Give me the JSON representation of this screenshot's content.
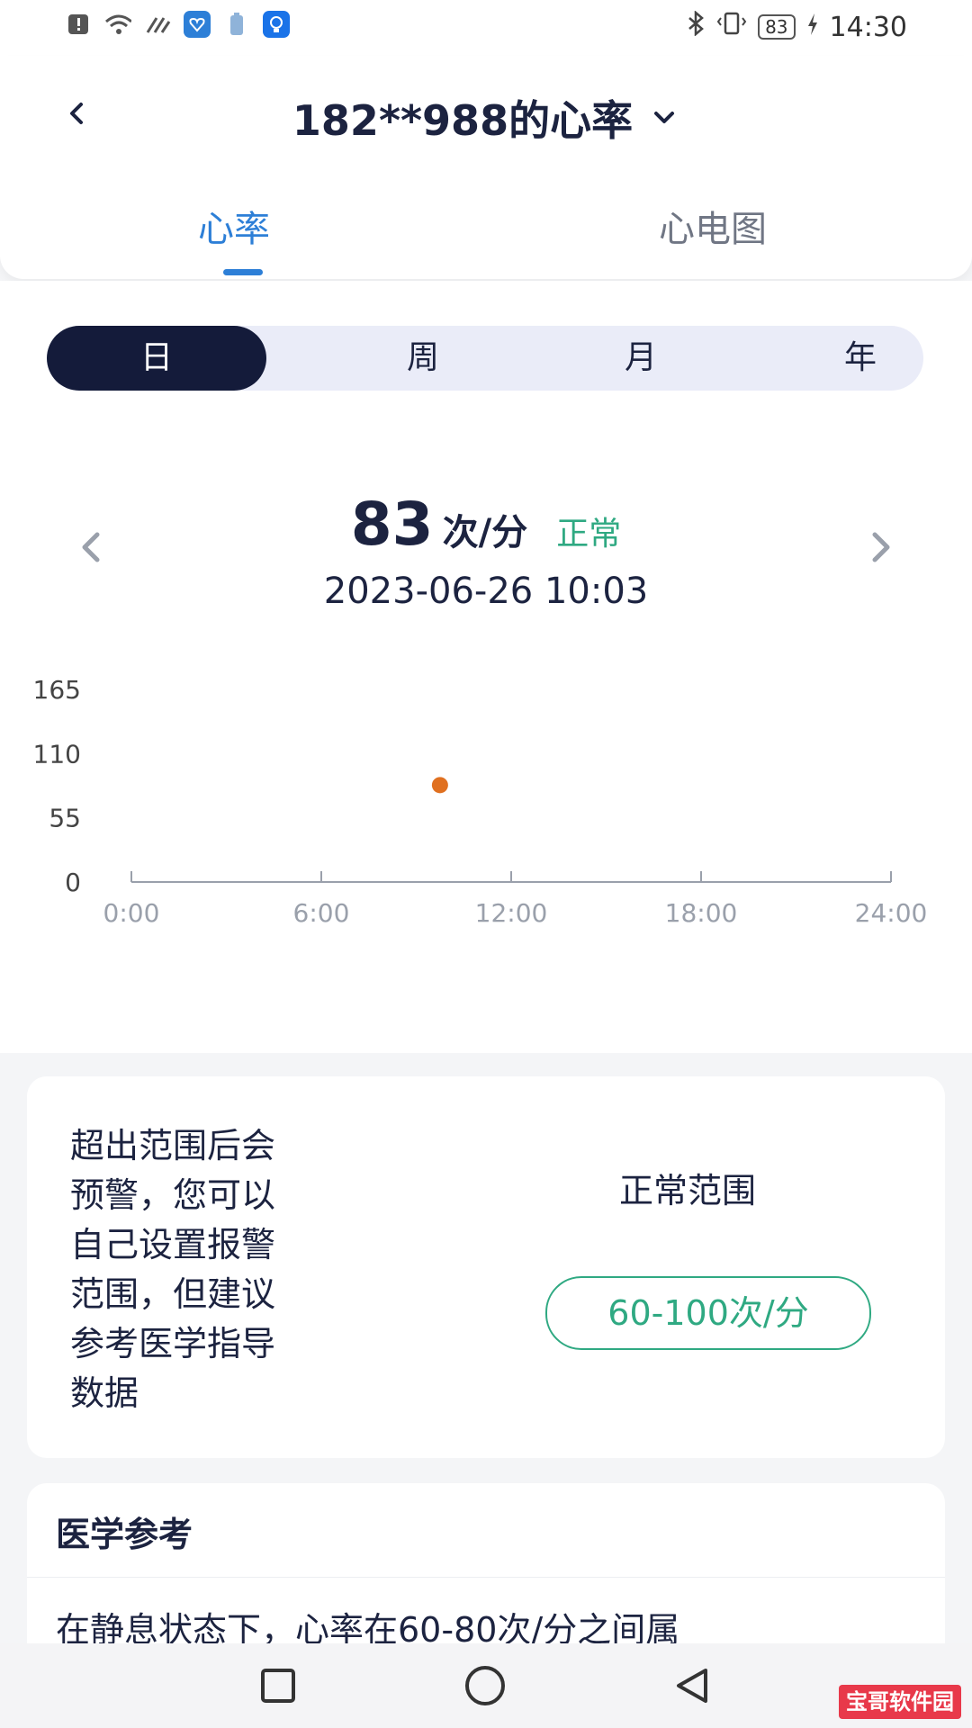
{
  "status_bar": {
    "time": "14:30",
    "battery": "83",
    "left_icons": [
      "alert-icon",
      "wifi-icon",
      "signal-icon",
      "app-heart-icon",
      "battery-small-icon",
      "bulb-icon"
    ],
    "right_icons": [
      "bluetooth-icon",
      "vibrate-icon",
      "battery-icon",
      "charging-icon"
    ]
  },
  "header": {
    "title": "182**988的心率",
    "tabs": [
      {
        "label": "心率",
        "active": true
      },
      {
        "label": "心电图",
        "active": false
      }
    ]
  },
  "period_selector": {
    "options": [
      "日",
      "周",
      "月",
      "年"
    ],
    "selected": "日"
  },
  "reading": {
    "value": "83",
    "unit": "次/分",
    "status": "正常",
    "timestamp": "2023-06-26 10:03"
  },
  "colors": {
    "accent": "#2d7fd7",
    "normal": "#2fa982",
    "dark": "#141b3a",
    "point": "#e07020"
  },
  "chart_data": {
    "type": "scatter",
    "x_ticks": [
      "0:00",
      "6:00",
      "12:00",
      "18:00",
      "24:00"
    ],
    "y_ticks": [
      "0",
      "55",
      "110",
      "165"
    ],
    "xlim": [
      0,
      24
    ],
    "ylim": [
      0,
      165
    ],
    "points": [
      {
        "x": 9.75,
        "y": 83
      }
    ],
    "grid": false
  },
  "range_card": {
    "description": [
      "超出范围后会",
      "预警，您可以",
      "自己设置报警",
      "范围，但建议",
      "参考医学指导",
      "数据"
    ],
    "title": "正常范围",
    "range": "60-100次/分"
  },
  "medical_reference": {
    "title": "医学参考",
    "text": "在静息状态下，心率在60-80次/分之间属"
  },
  "nav_bar": {
    "buttons": [
      "recent-apps",
      "home",
      "back"
    ]
  },
  "watermark": "宝哥软件园"
}
